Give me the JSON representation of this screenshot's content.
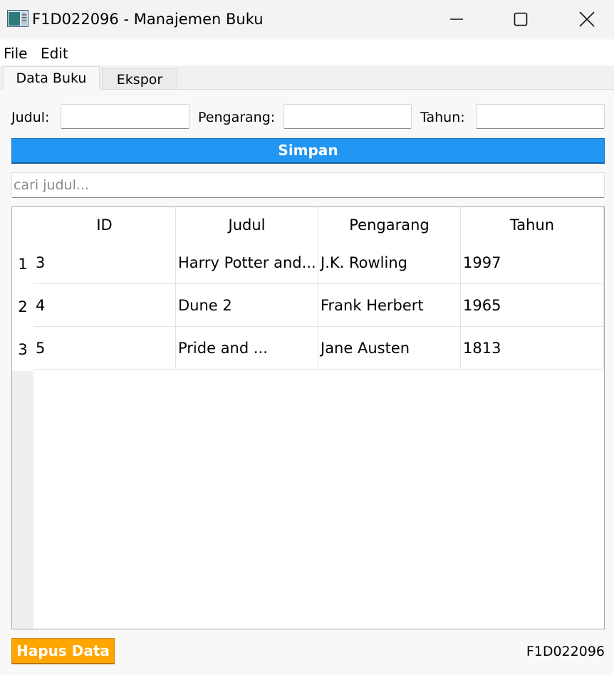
{
  "window": {
    "title": "F1D022096 - Manajemen Buku"
  },
  "menu": {
    "file": "File",
    "edit": "Edit"
  },
  "tabs": [
    {
      "label": "Data Buku",
      "active": true
    },
    {
      "label": "Ekspor",
      "active": false
    }
  ],
  "form": {
    "judul_label": "Judul:",
    "judul_value": "",
    "pengarang_label": "Pengarang:",
    "pengarang_value": "",
    "tahun_label": "Tahun:",
    "tahun_value": "",
    "save_label": "Simpan"
  },
  "search": {
    "placeholder": "cari judul...",
    "value": ""
  },
  "table": {
    "columns": [
      "ID",
      "Judul",
      "Pengarang",
      "Tahun"
    ],
    "rows": [
      {
        "num": "1",
        "cells": [
          "3",
          "Harry Potter and...",
          "J.K. Rowling",
          "1997"
        ]
      },
      {
        "num": "2",
        "cells": [
          "4",
          "Dune 2",
          "Frank Herbert",
          "1965"
        ]
      },
      {
        "num": "3",
        "cells": [
          "5",
          "Pride and ...",
          "Jane Austen",
          "1813"
        ]
      }
    ]
  },
  "footer": {
    "delete_label": "Hapus Data",
    "status_id": "F1D022096"
  },
  "colors": {
    "save_button": "#2196f3",
    "delete_button": "#ffa500"
  },
  "icons": {
    "app": "app-window-icon",
    "minimize": "minimize-icon",
    "maximize": "maximize-icon",
    "close": "close-icon"
  }
}
